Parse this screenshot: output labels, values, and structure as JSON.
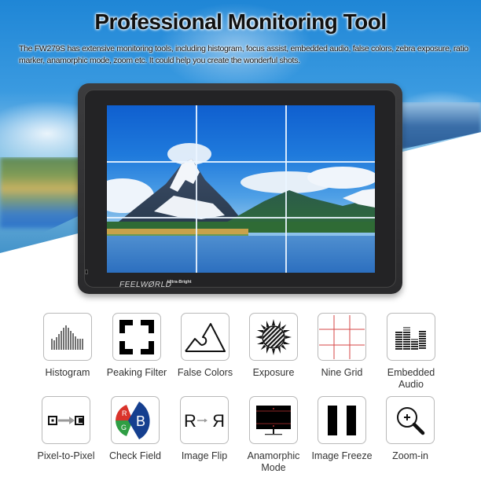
{
  "header": {
    "title": "Professional Monitoring Tool",
    "description": "The FW279S has extensive monitoring tools, including histogram, focus assist, embedded audio, false colors, zebra exposure, ratio marker, anamorphic mode, zoom etc. It could help you create the wonderful shots."
  },
  "monitor": {
    "brand": "FEELWØRLD",
    "badge": "Ultra-Bright",
    "screen_overlay": "nine-grid"
  },
  "colors": {
    "grid_red": "#d64545",
    "rgb_red": "#d9332b",
    "rgb_green": "#2f9e44",
    "rgb_blue": "#153f8f",
    "icon_border": "#b9b9b9",
    "label_text": "#333333"
  },
  "features": [
    {
      "label": "Histogram",
      "icon": "histogram-icon"
    },
    {
      "label": "Peaking Filter",
      "icon": "peaking-filter-icon"
    },
    {
      "label": "False Colors",
      "icon": "false-colors-icon"
    },
    {
      "label": "Exposure",
      "icon": "exposure-icon"
    },
    {
      "label": "Nine Grid",
      "icon": "nine-grid-icon"
    },
    {
      "label": "Embedded Audio",
      "icon": "embedded-audio-icon"
    },
    {
      "label": "Pixel-to-Pixel",
      "icon": "pixel-to-pixel-icon"
    },
    {
      "label": "Check Field",
      "icon": "check-field-icon",
      "letters": [
        "R",
        "G",
        "B"
      ]
    },
    {
      "label": "Image Flip",
      "icon": "image-flip-icon",
      "letters": [
        "R",
        "R"
      ]
    },
    {
      "label": "Anamorphic Mode",
      "icon": "anamorphic-mode-icon"
    },
    {
      "label": "Image Freeze",
      "icon": "image-freeze-icon"
    },
    {
      "label": "Zoom-in",
      "icon": "zoom-in-icon"
    }
  ]
}
